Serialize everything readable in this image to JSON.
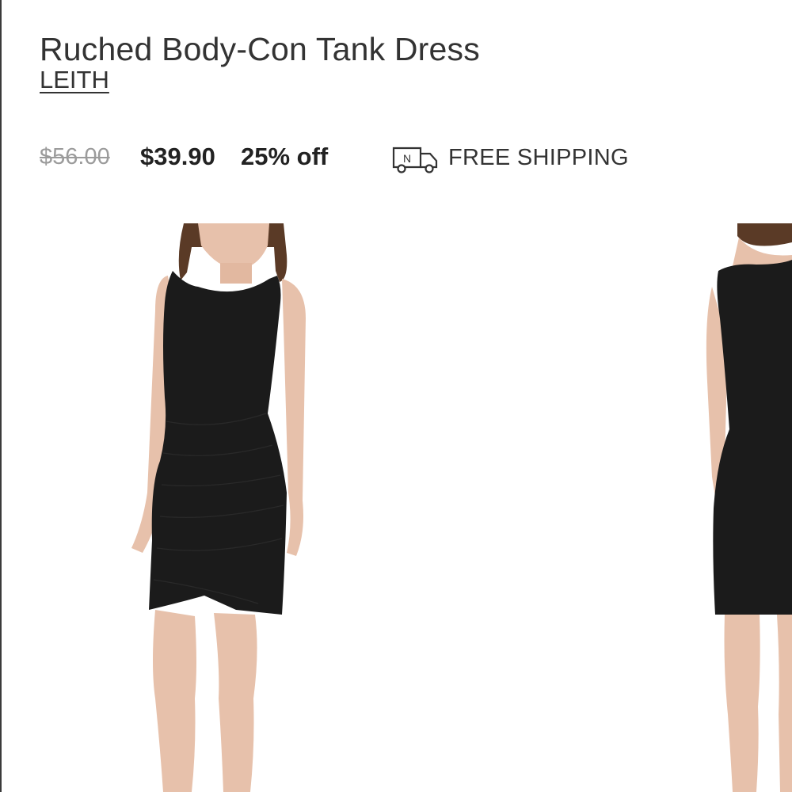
{
  "product": {
    "title": "Ruched Body-Con Tank Dress",
    "brand": "LEITH"
  },
  "pricing": {
    "original": "$56.00",
    "sale": "$39.90",
    "discount": "25% off"
  },
  "shipping": {
    "icon": "delivery-truck-icon",
    "icon_letter": "N",
    "label": "FREE SHIPPING"
  },
  "gallery": {
    "images": [
      {
        "name": "front-view",
        "alt": "Model wearing black ruched dress, front view"
      },
      {
        "name": "back-view",
        "alt": "Model wearing black ruched dress, back view"
      }
    ]
  },
  "colors": {
    "text": "#333333",
    "strike": "#9b9b9b",
    "dress": "#1b1b1b",
    "skin": "#e7c1ab",
    "hair": "#5a3a26"
  }
}
